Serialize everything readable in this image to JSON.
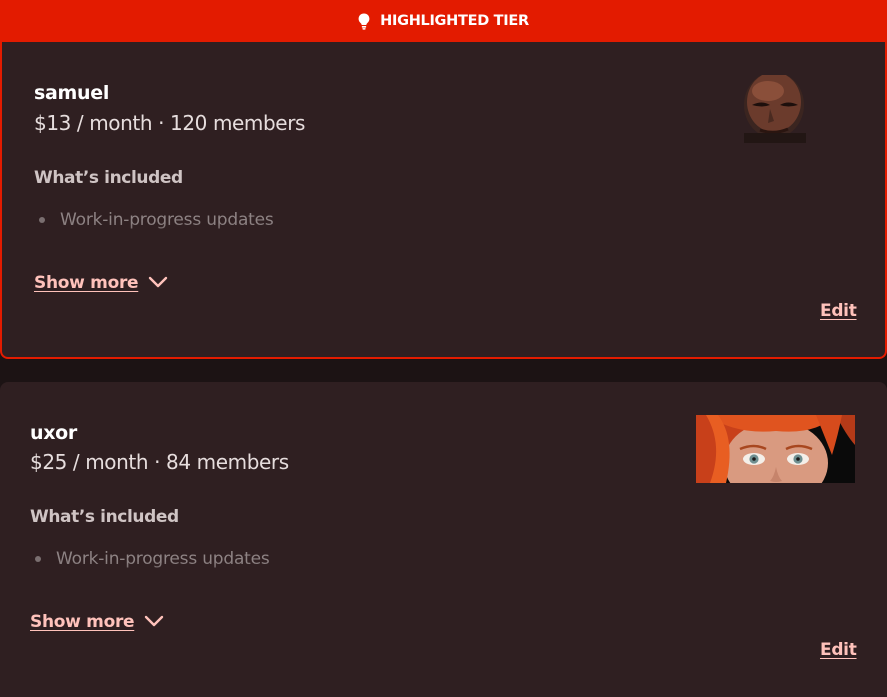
{
  "highlight_banner": {
    "label": "HIGHLIGHTED TIER",
    "icon": "lightbulb-icon",
    "color": "#e31b00"
  },
  "tiers": [
    {
      "name": "samuel",
      "price": "$13 / month · 120 members",
      "included_heading": "What’s included",
      "benefits": [
        "Work-in-progress updates"
      ],
      "show_more_label": "Show more",
      "edit_label": "Edit",
      "image_alt": "portrait of a bald man"
    },
    {
      "name": "uxor",
      "price": "$25 / month · 84 members",
      "included_heading": "What’s included",
      "benefits": [
        "Work-in-progress updates"
      ],
      "show_more_label": "Show more",
      "edit_label": "Edit",
      "image_alt": "close-up of a red-haired woman"
    }
  ],
  "colors": {
    "accent": "#e31b00",
    "card_background": "#2f1f21",
    "link": "#ffc2bb"
  }
}
